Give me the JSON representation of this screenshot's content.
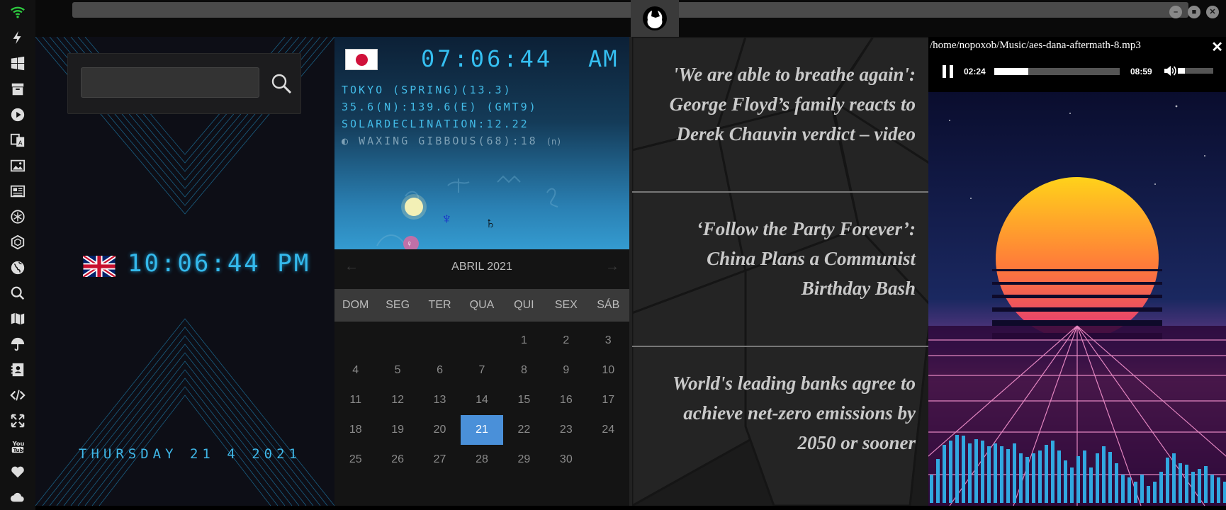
{
  "sidebar": {
    "icons": [
      "wifi-icon",
      "lightning-icon",
      "windows-icon",
      "archive-icon",
      "play-icon",
      "translate-icon",
      "image-icon",
      "newspaper-icon",
      "atom-icon",
      "hexagon-icon",
      "globe-icon",
      "search-icon",
      "map-icon",
      "umbrella-icon",
      "contacts-icon",
      "code-icon",
      "fullscreen-icon",
      "youtube-icon",
      "heart-icon",
      "cloud-icon"
    ],
    "accent": "#2ecc40"
  },
  "topbar": {
    "logo": "rebel-alliance-icon"
  },
  "left_clock": {
    "search_placeholder": "",
    "flag": "uk-flag",
    "time": "10:06:44 PM",
    "date": "THURSDAY 21 4 2021"
  },
  "tokyo": {
    "time": "07:06:44",
    "ampm": "AM",
    "line1": "TOKYO (SPRING)(13.3)",
    "line2": "35.6(N):139.6(E) (GMT9)",
    "line3": "SOLARDECLINATION:12.22",
    "moon": "WAXING GIBBOUS(68):18",
    "moon_suffix": "(n)",
    "planet_neptune": "♆",
    "planet_saturn": "♄",
    "planet_venus": "♀"
  },
  "calendar": {
    "month": "ABRIL 2021",
    "prev": "←",
    "next": "→",
    "weekdays": [
      "DOM",
      "SEG",
      "TER",
      "QUA",
      "QUI",
      "SEX",
      "SÁB"
    ],
    "weeks": [
      [
        "",
        "",
        "",
        "",
        "1",
        "2",
        "3"
      ],
      [
        "4",
        "5",
        "6",
        "7",
        "8",
        "9",
        "10"
      ],
      [
        "11",
        "12",
        "13",
        "14",
        "15",
        "16",
        "17"
      ],
      [
        "18",
        "19",
        "20",
        "21",
        "22",
        "23",
        "24"
      ],
      [
        "25",
        "26",
        "27",
        "28",
        "29",
        "30",
        ""
      ]
    ],
    "today": "21"
  },
  "news": {
    "items": [
      "'We are able to breathe again': George Floyd’s family reacts to Derek Chauvin verdict – video",
      "‘Follow the Party Forever’: China Plans a Communist Birthday Bash",
      "World's leading banks agree to achieve net-zero emissions by 2050 or sooner"
    ]
  },
  "media": {
    "path": "/home/nopoxob/Music/aes-dana-aftermath-8.mp3",
    "close": "✕",
    "current_time": "02:24",
    "total_time": "08:59",
    "progress": 0.27,
    "volume": 0.2
  }
}
